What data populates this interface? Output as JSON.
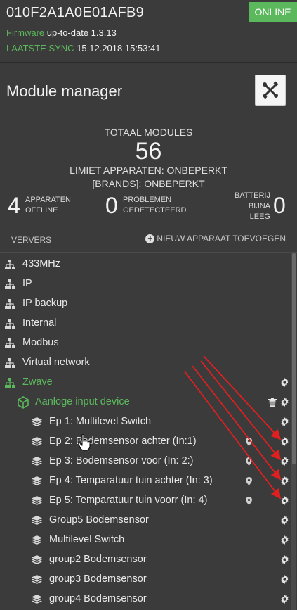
{
  "header": {
    "device_id": "010F2A1A0E01AFB9",
    "status": "ONLINE",
    "firmware_label": "Firmware",
    "firmware_value": "up-to-date 1.3.13",
    "sync_label": "LAATSTE SYNC",
    "sync_value": "15.12.2018 15:53:41"
  },
  "module_bar": {
    "title": "Module manager",
    "icon": "tools-icon"
  },
  "stats": {
    "total_label": "TOTAAL MODULES",
    "total_value": "56",
    "limit_devices": "LIMIET APPARATEN: ONBEPERKT",
    "limit_brands": "[BRANDS]: ONBEPERKT",
    "offline_count": "4",
    "offline_label_1": "APPARATEN",
    "offline_label_2": "OFFLINE",
    "problems_count": "0",
    "problems_label_1": "PROBLEMEN",
    "problems_label_2": "GEDETECTEERD",
    "battery_count": "0",
    "battery_label_1": "BATTERIJ",
    "battery_label_2": "BIJNA",
    "battery_label_3": "LEEG"
  },
  "toolbar": {
    "refresh": "VERVERS",
    "new_device": "NIEUW APPARAAT TOEVOEGEN"
  },
  "tree": {
    "networks": [
      {
        "label": "433MHz"
      },
      {
        "label": "IP"
      },
      {
        "label": "IP backup"
      },
      {
        "label": "Internal"
      },
      {
        "label": "Modbus"
      },
      {
        "label": "Virtual network"
      },
      {
        "label": "Zwave"
      }
    ],
    "device": {
      "label": "Aanloge input device"
    },
    "endpoints": [
      {
        "label": "Ep 1: Multilevel Switch"
      },
      {
        "label": "Ep 2: Bodemsensor achter (In:1)"
      },
      {
        "label": "Ep 3: Bodemsensor voor (In: 2:)"
      },
      {
        "label": "Ep 4: Temparatuur tuin achter (In: 3)"
      },
      {
        "label": "Ep 5: Temparatuur tuin voorr (In: 4)"
      },
      {
        "label": "Group5 Bodemsensor"
      },
      {
        "label": "Multilevel Switch"
      },
      {
        "label": "group2 Bodemsensor"
      },
      {
        "label": "group3 Bodemsensor"
      },
      {
        "label": "group4 Bodemsensor"
      }
    ]
  },
  "colors": {
    "accent_green": "#5cb85c",
    "background": "#3b3b3b",
    "annotation_red": "#e02020"
  }
}
